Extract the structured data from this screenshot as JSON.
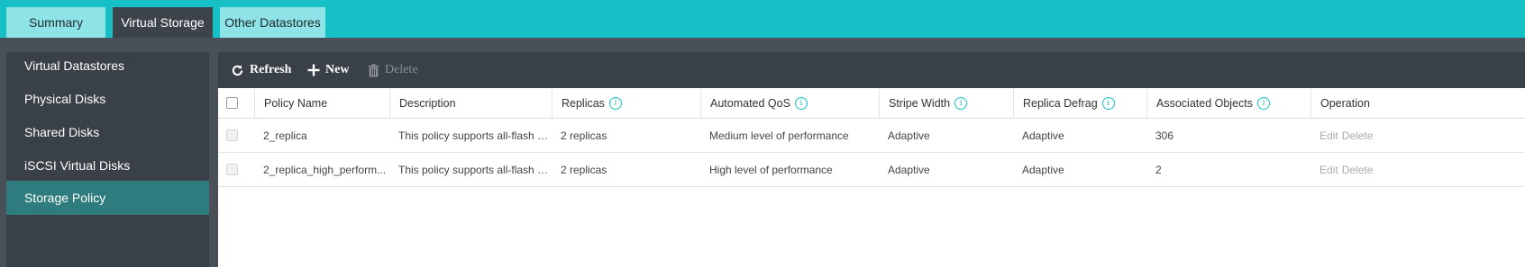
{
  "tabs": [
    {
      "label": "Summary"
    },
    {
      "label": "Virtual Storage"
    },
    {
      "label": "Other Datastores"
    }
  ],
  "sidebar": {
    "items": [
      {
        "label": "Virtual Datastores"
      },
      {
        "label": "Physical Disks"
      },
      {
        "label": "Shared Disks"
      },
      {
        "label": "iSCSI Virtual Disks"
      },
      {
        "label": "Storage Policy"
      }
    ]
  },
  "toolbar": {
    "refresh_label": "Refresh",
    "new_label": "New",
    "delete_label": "Delete"
  },
  "table": {
    "columns": [
      "Policy Name",
      "Description",
      "Replicas",
      "Automated QoS",
      "Stripe Width",
      "Replica Defrag",
      "Associated Objects",
      "Operation"
    ],
    "info_glyph": "i",
    "rows": [
      {
        "name": "2_replica",
        "description": "This policy supports all-flash d...",
        "replicas": "2 replicas",
        "qos": "Medium level of performance",
        "stripe": "Adaptive",
        "defrag": "Adaptive",
        "objects": "306",
        "edit": "Edit",
        "delete": "Delete"
      },
      {
        "name": "2_replica_high_perform...",
        "description": "This policy supports all-flash d...",
        "replicas": "2 replicas",
        "qos": "High level of performance",
        "stripe": "Adaptive",
        "defrag": "Adaptive",
        "objects": "2",
        "edit": "Edit",
        "delete": "Delete"
      }
    ]
  },
  "colors": {
    "accent": "#17bfc7",
    "active_sidebar": "#2f7c7e",
    "dark_panel": "#3a4047"
  },
  "icons": {
    "refresh": "refresh-icon",
    "new": "plus-icon",
    "delete": "trash-icon",
    "info": "info-icon"
  }
}
